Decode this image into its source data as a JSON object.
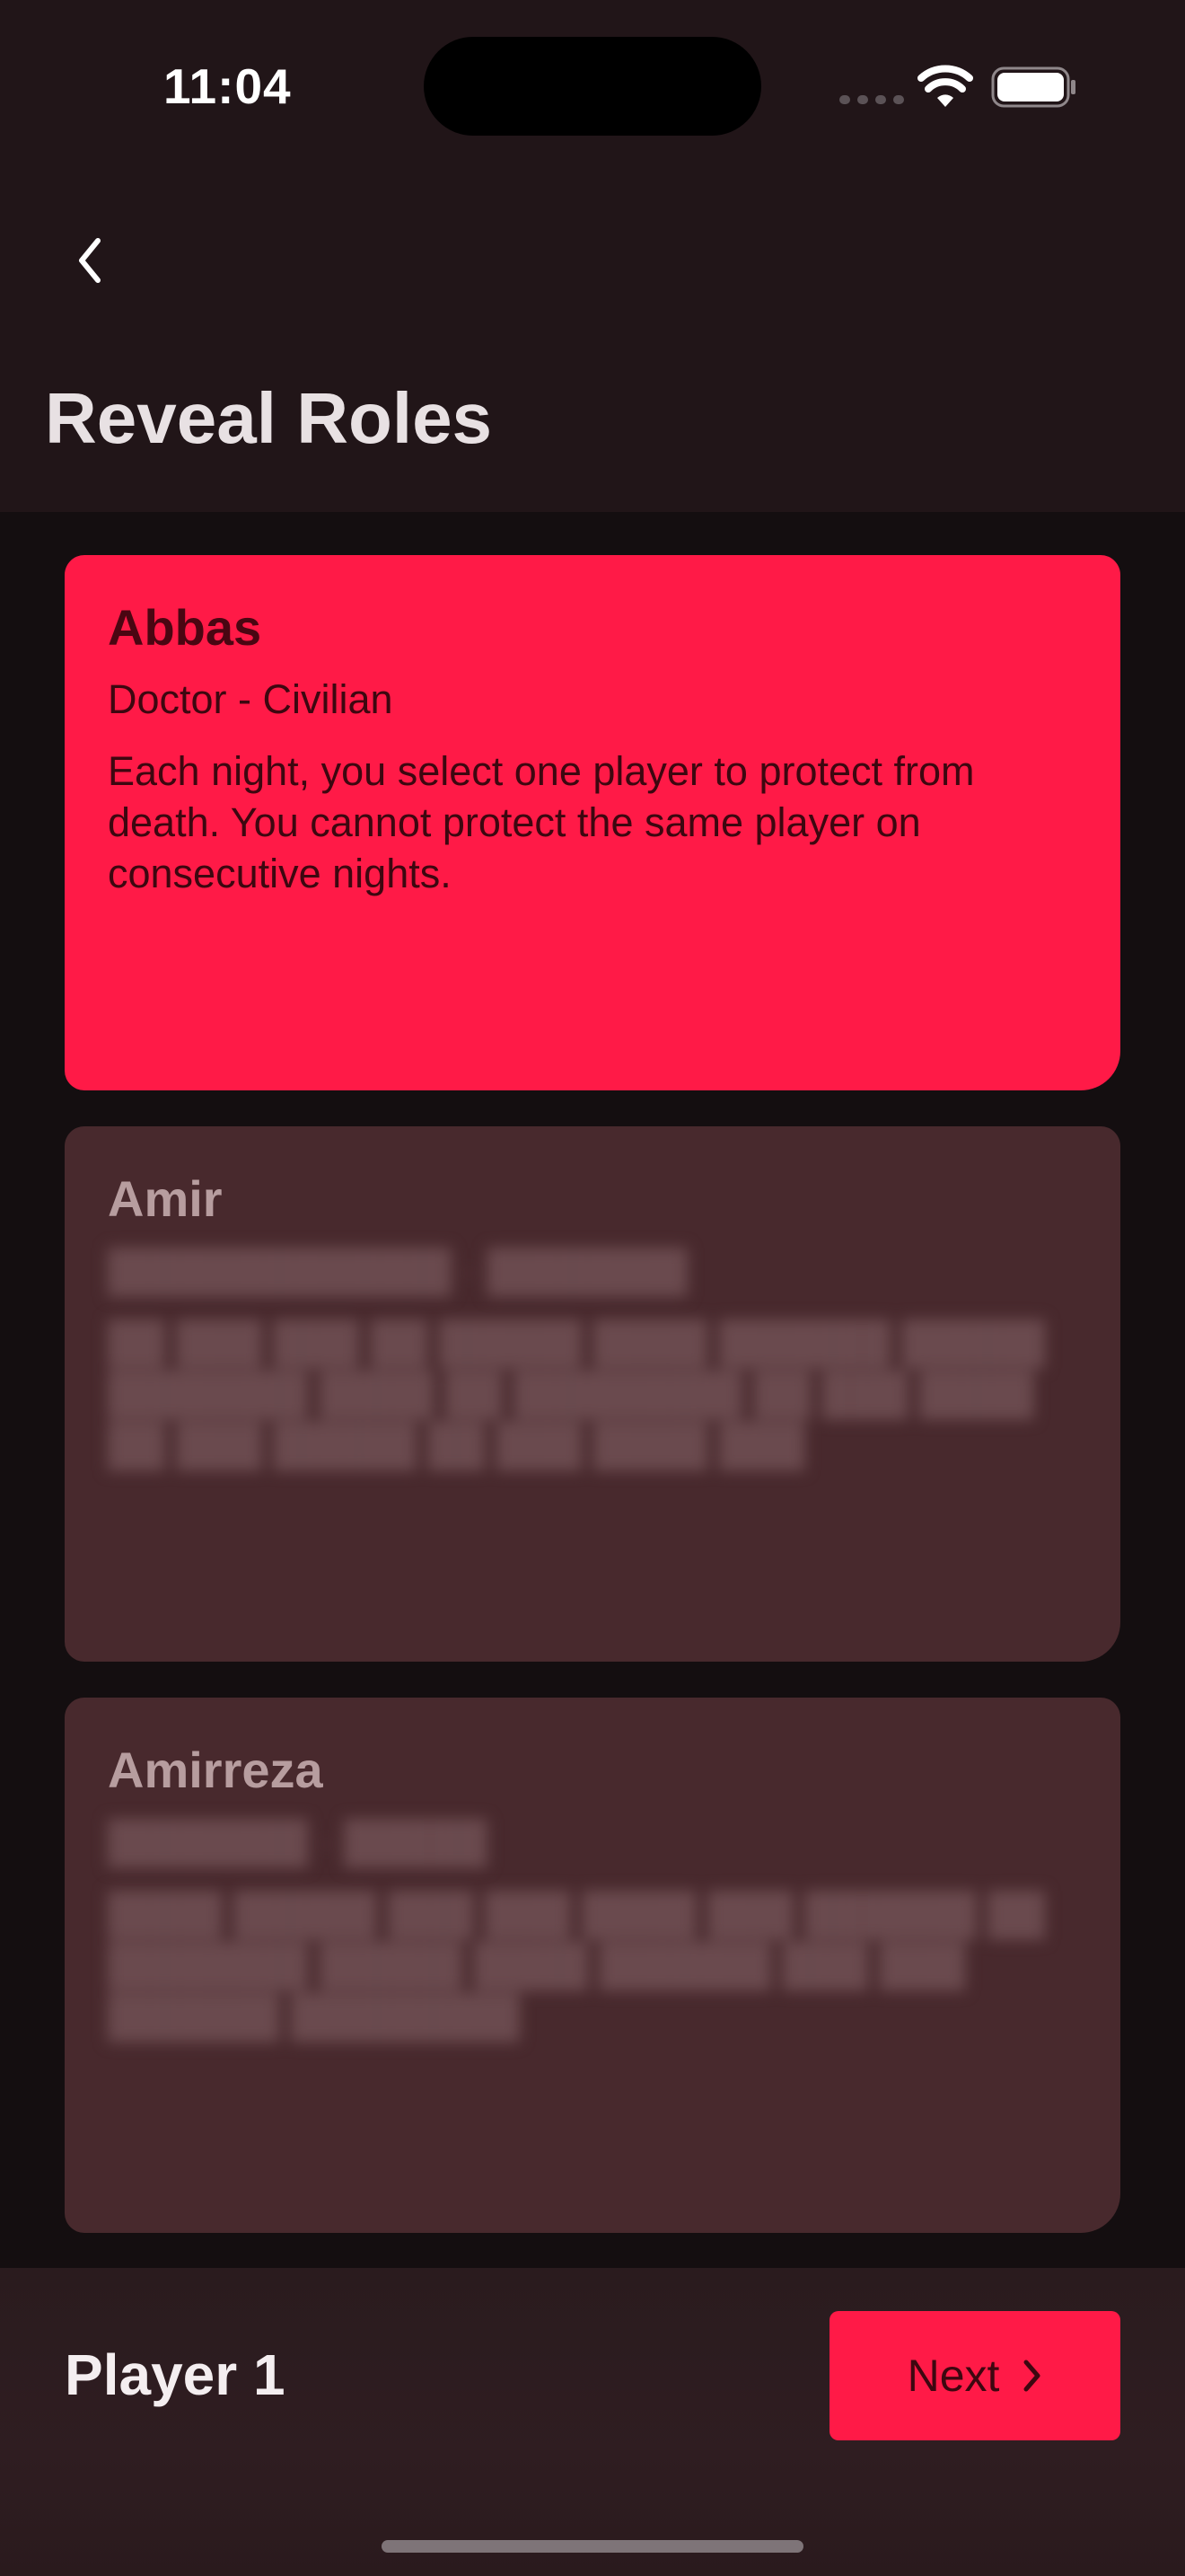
{
  "status_bar": {
    "time": "11:04"
  },
  "header": {
    "back_icon": "chevron-left-icon",
    "title": "Reveal Roles"
  },
  "colors": {
    "accent": "#ff1a47",
    "background": "#140e10",
    "header_bg": "#211518",
    "hidden_card_bg": "#48292d"
  },
  "cards": [
    {
      "name": "Abbas",
      "role": "Doctor - Civilian",
      "description": "Each night, you select one player to protect from death. You cannot protect the same player on consecutive nights.",
      "revealed": true
    },
    {
      "name": "Amir",
      "role": "",
      "description": "",
      "revealed": false
    },
    {
      "name": "Amirreza",
      "role": "",
      "description": "",
      "revealed": false
    }
  ],
  "footer": {
    "player_label": "Player 1",
    "next_label": "Next",
    "next_icon": "chevron-right-icon"
  }
}
